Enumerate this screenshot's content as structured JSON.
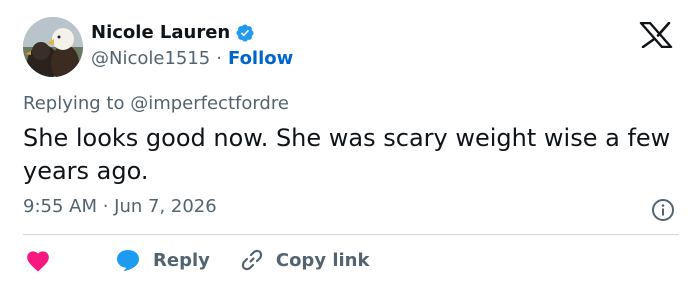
{
  "author": {
    "name": "Nicole Lauren",
    "handle": "@Nicole1515",
    "separator": "·",
    "follow_label": "Follow",
    "avatar_icon": "eagle-avatar",
    "verified_icon": "verified-badge-icon"
  },
  "brand": {
    "logo_icon": "x-logo-icon"
  },
  "tweet": {
    "replying_to": "Replying to @imperfectfordre",
    "text": "She looks good now. She was scary weight wise a few years ago.",
    "timestamp": "9:55 AM · Jun 7, 2026"
  },
  "actions": {
    "like_icon": "heart-icon",
    "reply_label": "Reply",
    "reply_icon": "speech-bubble-icon",
    "copy_label": "Copy link",
    "copy_icon": "link-icon",
    "info_icon": "info-icon"
  },
  "colors": {
    "accent": "#0066cc",
    "verified": "#1d9bf0",
    "heart": "#f91880",
    "text": "#0f1419",
    "muted": "#536471",
    "divider": "#cfd9de"
  }
}
